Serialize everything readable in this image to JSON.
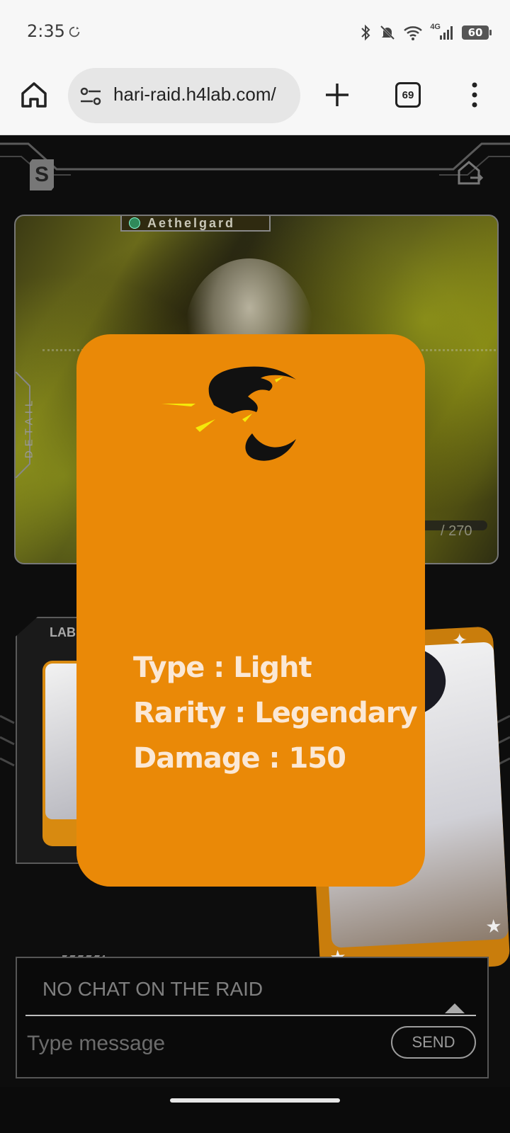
{
  "status_bar": {
    "time": "2:35",
    "network": "4G",
    "battery": "60",
    "icons": [
      "sync-icon",
      "bluetooth-icon",
      "mute-icon",
      "wifi-icon",
      "signal-icon",
      "battery-icon"
    ]
  },
  "browser": {
    "url": "hari-raid.h4lab.com/",
    "tab_count": "69",
    "icons": [
      "home-icon",
      "site-settings-icon",
      "new-tab-icon",
      "tabs-icon",
      "overflow-menu-icon"
    ]
  },
  "raid": {
    "boss_name": "Aethelgard",
    "detail_label": "DETAIL",
    "hp_text": "/ 270",
    "lab_label": "LAB"
  },
  "card_popup": {
    "type_line": "Type : Light",
    "rarity_line": "Rarity : Legendary",
    "damage_line": "Damage : 150",
    "accent": "#ea8907"
  },
  "chat": {
    "empty_text": "NO CHAT ON THE RAID",
    "placeholder": "Type message",
    "send_label": "SEND"
  }
}
